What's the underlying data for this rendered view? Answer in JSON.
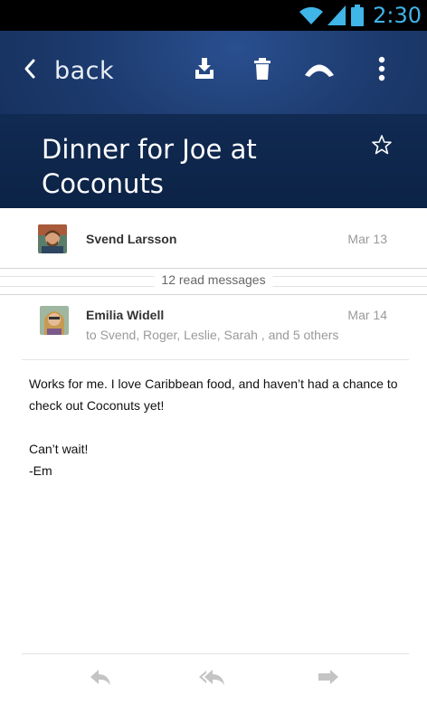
{
  "status_bar": {
    "time": "2:30",
    "icons": [
      "wifi-icon",
      "signal-icon",
      "battery-icon"
    ],
    "clock_color": "#3fb5e8"
  },
  "toolbar": {
    "back_label": "back",
    "actions": [
      "archive-icon",
      "trash-icon",
      "boomerang-icon",
      "overflow-menu-icon"
    ]
  },
  "thread": {
    "subject": "Dinner for Joe at Coconuts",
    "starred": false
  },
  "messages": [
    {
      "sender": "Svend Larsson",
      "date": "Mar 13"
    },
    {
      "sender": "Emilia Widell",
      "date": "Mar 14",
      "recipients": "to Svend, Roger, Leslie, Sarah , and 5 others",
      "body_line1": "Works for me. I love Caribbean food, and haven’t had a chance to check out Coconuts yet!",
      "body_line2": "Can’t wait!",
      "body_line3": "-Em"
    }
  ],
  "collapsed": {
    "label": "12 read messages"
  },
  "bottom_actions": [
    "reply-icon",
    "reply-all-icon",
    "forward-icon"
  ],
  "colors": {
    "header_blue": "#1c3a6d",
    "subject_band": "#0c2346",
    "muted_text": "#9a9a9a"
  }
}
